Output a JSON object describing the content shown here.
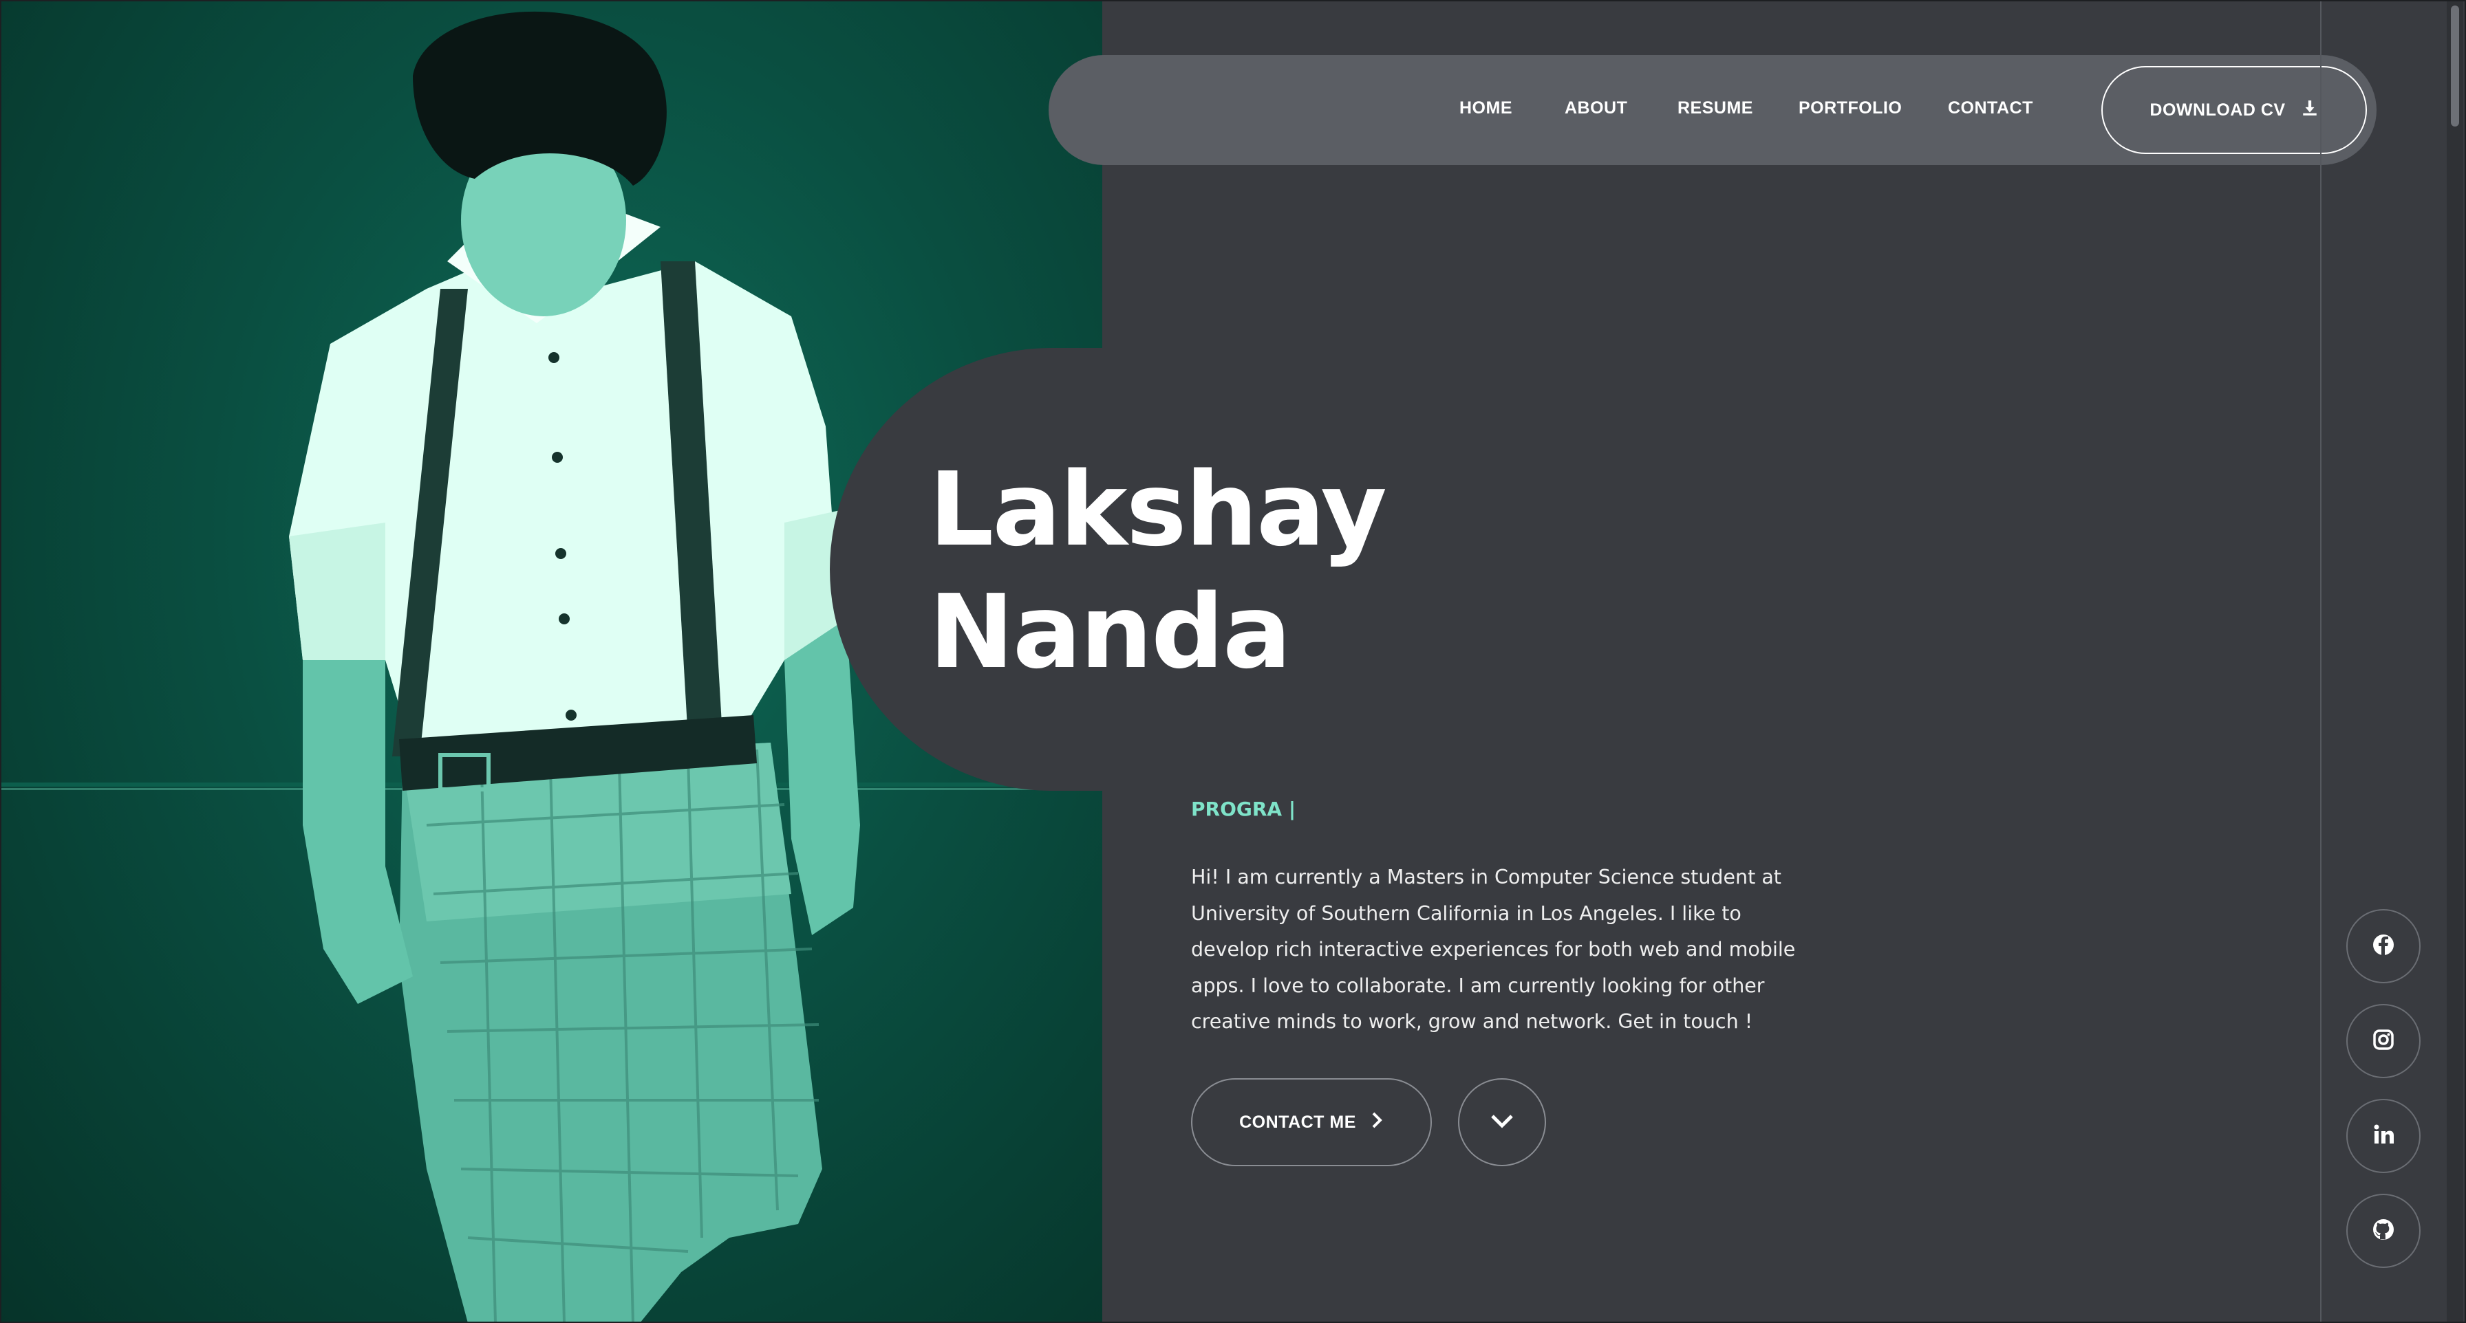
{
  "nav": {
    "links": [
      "HOME",
      "ABOUT",
      "RESUME",
      "PORTFOLIO",
      "CONTACT"
    ],
    "download_label": "DOWNLOAD CV",
    "download_icon": "download-icon"
  },
  "hero": {
    "first_name": "Lakshay",
    "last_name": "Nanda",
    "role": "PROGRA |",
    "bio": "Hi! I am currently a Masters in Computer Science student at University of Southern California in Los Angeles. I like to develop rich interactive experiences for both web and mobile apps. I love to collaborate. I am currently looking for other creative minds to work, grow and network. Get in touch !",
    "contact_label": "CONTACT ME",
    "contact_icon": "chevron-right-icon",
    "scroll_icon": "chevron-down-icon"
  },
  "social": [
    "facebook-icon",
    "instagram-icon",
    "linkedin-icon",
    "github-icon"
  ],
  "colors": {
    "background": "#393b40",
    "navbar": "#5b5e64",
    "accent": "#7fe3c9",
    "photo_tint": "#0a4f41"
  }
}
